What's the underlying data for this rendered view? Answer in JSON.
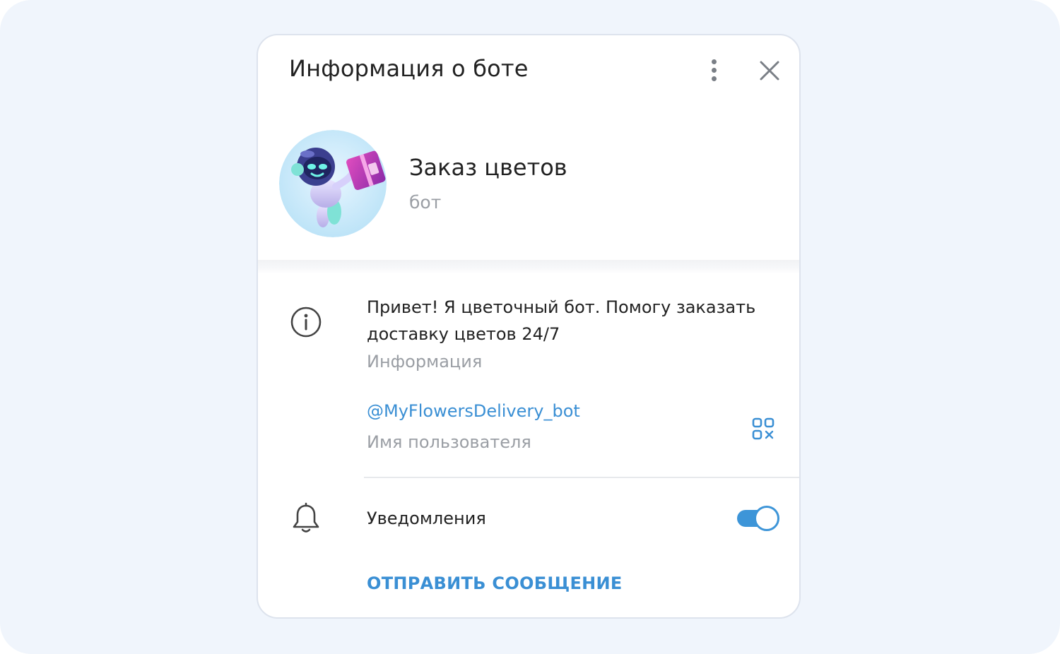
{
  "dialog": {
    "title": "Информация о боте",
    "menu_icon": "more-vertical-icon",
    "close_icon": "close-icon"
  },
  "profile": {
    "name": "Заказ цветов",
    "subtitle": "бот"
  },
  "info": {
    "icon": "info-icon",
    "description": "Привет! Я цветочный бот. Помогу заказать доставку цветов 24/7",
    "description_label": "Информация",
    "username": "@MyFlowersDelivery_bot",
    "username_label": "Имя пользователя",
    "qr_icon": "qr-code-icon"
  },
  "notifications": {
    "icon": "bell-icon",
    "label": "Уведомления",
    "enabled": true
  },
  "actions": {
    "send_message": "ОТПРАВИТЬ СООБЩЕНИЕ"
  },
  "colors": {
    "accent": "#3a8fd4",
    "background": "#f0f5fc"
  }
}
